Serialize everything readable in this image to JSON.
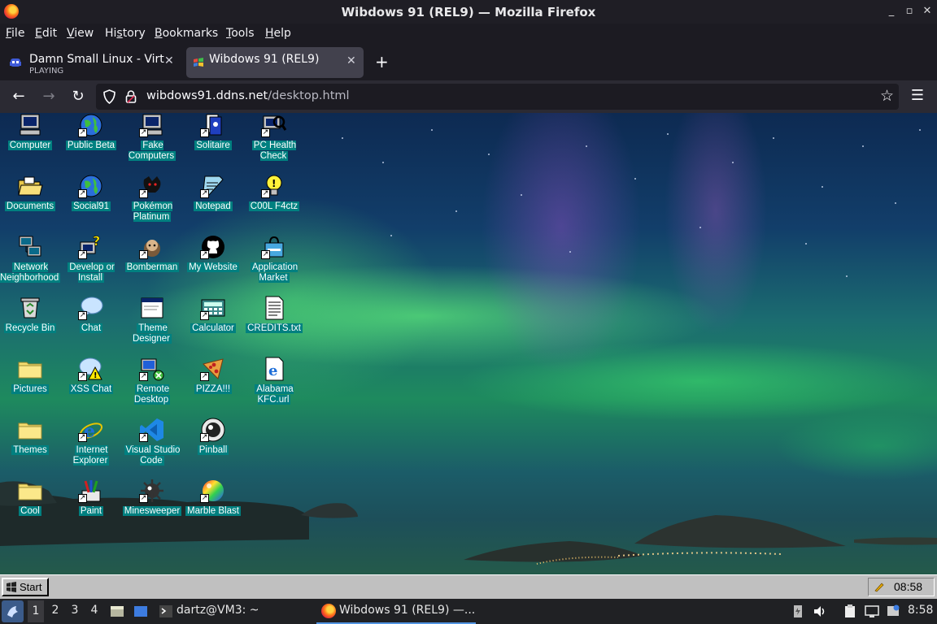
{
  "window": {
    "title": "Wibdows 91 (REL9) — Mozilla Firefox",
    "controls": {
      "minimize": "_",
      "restore": "▫",
      "maximize": "▢",
      "close": "✕"
    }
  },
  "menubar": {
    "items": [
      {
        "label": "File",
        "mn": "F",
        "rest": "ile"
      },
      {
        "label": "Edit",
        "mn": "E",
        "rest": "dit"
      },
      {
        "label": "View",
        "mn": "V",
        "rest": "iew"
      },
      {
        "label": "History",
        "mn": "s",
        "pre": "Hi",
        "rest": "tory"
      },
      {
        "label": "Bookmarks",
        "mn": "B",
        "rest": "ookmarks"
      },
      {
        "label": "Tools",
        "mn": "T",
        "rest": "ools"
      },
      {
        "label": "Help",
        "mn": "H",
        "rest": "elp"
      }
    ]
  },
  "tabs": [
    {
      "label": "Damn Small Linux - Virtu",
      "sublabel": "PLAYING",
      "close": "✕"
    },
    {
      "label": "Wibdows 91 (REL9)",
      "close": "✕"
    }
  ],
  "newtab": "+",
  "nav": {
    "back": "←",
    "forward": "→",
    "reload": "↻",
    "url_host": "wibdows91.ddns.net",
    "url_path": "/desktop.html",
    "bookmark_star": "☆",
    "menu": "☰"
  },
  "desktop_icons": [
    {
      "label": "Computer",
      "icon": "computer-icon",
      "shortcut": false
    },
    {
      "label": "Public Beta",
      "icon": "globe-icon",
      "shortcut": true
    },
    {
      "label": "Fake Computers",
      "icon": "computer-icon",
      "shortcut": true
    },
    {
      "label": "Solitaire",
      "icon": "cards-icon",
      "shortcut": true
    },
    {
      "label": "PC Health Check",
      "icon": "magnifier-icon",
      "shortcut": true
    },
    {
      "label": "Documents",
      "icon": "folder-open-icon",
      "shortcut": false
    },
    {
      "label": "Social91",
      "icon": "globe-icon",
      "shortcut": true
    },
    {
      "label": "Pokémon Platinum",
      "icon": "pokemon-icon",
      "shortcut": true
    },
    {
      "label": "Notepad",
      "icon": "notepad-icon",
      "shortcut": true
    },
    {
      "label": "C00L F4ctz",
      "icon": "lightbulb-icon",
      "shortcut": true
    },
    {
      "label": "Network Neighborhood",
      "icon": "network-icon",
      "shortcut": false
    },
    {
      "label": "Develop or Install",
      "icon": "help-computer-icon",
      "shortcut": true
    },
    {
      "label": "Bomberman",
      "icon": "bomberman-icon",
      "shortcut": true
    },
    {
      "label": "My Website",
      "icon": "github-icon",
      "shortcut": true
    },
    {
      "label": "Application Market",
      "icon": "shopping-bag-icon",
      "shortcut": true
    },
    {
      "label": "Recycle Bin",
      "icon": "recycle-bin-icon",
      "shortcut": false
    },
    {
      "label": "Chat",
      "icon": "chat-bubble-icon",
      "shortcut": true
    },
    {
      "label": "Theme Designer",
      "icon": "window-icon",
      "shortcut": false
    },
    {
      "label": "Calculator",
      "icon": "calculator-icon",
      "shortcut": true
    },
    {
      "label": "CREDITS.txt",
      "icon": "text-file-icon",
      "shortcut": false
    },
    {
      "label": "Pictures",
      "icon": "folder-icon",
      "shortcut": false
    },
    {
      "label": "XSS Chat",
      "icon": "chat-warning-icon",
      "shortcut": true
    },
    {
      "label": "Remote Desktop",
      "icon": "remote-desktop-icon",
      "shortcut": true
    },
    {
      "label": "PIZZA!!!",
      "icon": "pizza-icon",
      "shortcut": true
    },
    {
      "label": "Alabama KFC.url",
      "icon": "ie-document-icon",
      "shortcut": false
    },
    {
      "label": "Themes",
      "icon": "folder-icon",
      "shortcut": false
    },
    {
      "label": "Internet Explorer",
      "icon": "ie-icon",
      "shortcut": true
    },
    {
      "label": "Visual Studio Code",
      "icon": "vscode-icon",
      "shortcut": true
    },
    {
      "label": "Pinball",
      "icon": "pinball-icon",
      "shortcut": true
    },
    {
      "label": "Cool",
      "icon": "folder-icon",
      "shortcut": false
    },
    {
      "label": "Paint",
      "icon": "paint-icon",
      "shortcut": true
    },
    {
      "label": "Minesweeper",
      "icon": "mine-icon",
      "shortcut": true
    },
    {
      "label": "Marble Blast",
      "icon": "marble-icon",
      "shortcut": true
    }
  ],
  "w91_taskbar": {
    "start_label": "Start",
    "time": "08:58"
  },
  "linux_panel": {
    "workspaces": [
      "1",
      "2",
      "3",
      "4"
    ],
    "terminal_task": "dartz@VM3: ~",
    "firefox_task": "Wibdows 91 (REL9) —...",
    "time": "8:58"
  },
  "colors": {
    "label_bg": "#008080",
    "w91_gray": "#c0c0c0",
    "firefox_dark": "#1c1b22"
  }
}
